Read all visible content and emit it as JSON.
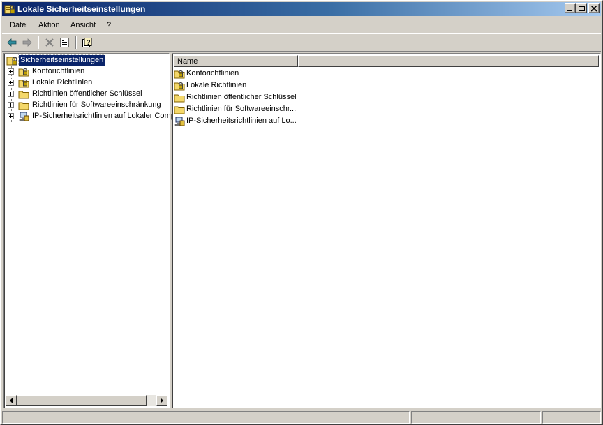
{
  "window": {
    "title": "Lokale Sicherheitseinstellungen",
    "icons": {
      "app": "security-settings-icon",
      "minimize": "minimize-icon",
      "maximize": "maximize-icon",
      "close": "close-icon"
    }
  },
  "menu": {
    "items": [
      {
        "label": "Datei"
      },
      {
        "label": "Aktion"
      },
      {
        "label": "Ansicht"
      },
      {
        "label": "?"
      }
    ]
  },
  "toolbar": {
    "icons": [
      "back-arrow-icon",
      "forward-arrow-icon",
      "delete-icon",
      "properties-icon",
      "help-icon"
    ]
  },
  "tree": {
    "root": {
      "label": "Sicherheitseinstellungen",
      "icon": "security-settings-icon",
      "selected": true
    },
    "items": [
      {
        "label": "Kontorichtlinien",
        "icon": "folder-lock-icon"
      },
      {
        "label": "Lokale Richtlinien",
        "icon": "folder-lock-icon"
      },
      {
        "label": "Richtlinien öffentlicher Schlüssel",
        "icon": "folder-icon"
      },
      {
        "label": "Richtlinien für Softwareeinschränkung",
        "icon": "folder-icon"
      },
      {
        "label": "IP-Sicherheitsrichtlinien auf Lokaler Comp",
        "icon": "ip-security-icon"
      }
    ]
  },
  "list": {
    "columns": [
      {
        "label": "Name"
      }
    ],
    "rows": [
      {
        "label": "Kontorichtlinien",
        "icon": "folder-lock-icon"
      },
      {
        "label": "Lokale Richtlinien",
        "icon": "folder-lock-icon"
      },
      {
        "label": "Richtlinien öffentlicher Schlüssel",
        "icon": "folder-icon"
      },
      {
        "label": "Richtlinien für Softwareeinschr...",
        "icon": "folder-icon"
      },
      {
        "label": "IP-Sicherheitsrichtlinien auf Lo...",
        "icon": "ip-security-icon"
      }
    ]
  },
  "colors": {
    "title_gradient_start": "#0a246a",
    "title_gradient_end": "#a6caf0",
    "face": "#d4d0c8",
    "selection": "#0a246a",
    "folder": "#f4d86a"
  }
}
